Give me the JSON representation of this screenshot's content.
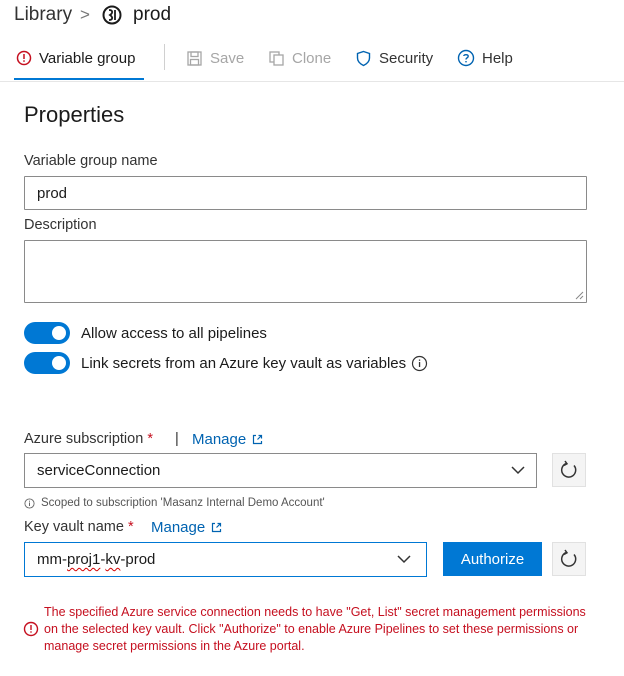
{
  "breadcrumb": {
    "root": "Library",
    "current": "prod"
  },
  "toolbar": {
    "variable_group": "Variable group",
    "save": "Save",
    "clone": "Clone",
    "security": "Security",
    "help": "Help"
  },
  "properties": {
    "title": "Properties",
    "name_label": "Variable group name",
    "name_value": "prod",
    "description_label": "Description",
    "description_value": ""
  },
  "toggles": {
    "allow_access": "Allow access to all pipelines",
    "allow_access_on": true,
    "link_secrets": "Link secrets from an Azure key vault as variables",
    "link_secrets_on": true
  },
  "subscription": {
    "label": "Azure subscription",
    "required_mark": "*",
    "separator": "|",
    "manage": "Manage",
    "value": "serviceConnection",
    "scope_hint": "Scoped to subscription 'Masanz Internal Demo Account'"
  },
  "keyvault": {
    "label": "Key vault name",
    "required_mark": "*",
    "manage": "Manage",
    "value_prefix": "mm-",
    "value_squiggle1": "proj1",
    "value_mid": "-",
    "value_squiggle2": "kv",
    "value_suffix": "-prod",
    "authorize": "Authorize"
  },
  "error": {
    "line1": "The specified Azure service connection needs to have \"Get, List\" secret management permissions",
    "line2": "on the selected key vault. Click \"Authorize\" to enable Azure Pipelines to set these permissions or",
    "line3": "manage secret permissions in the Azure portal."
  },
  "colors": {
    "accent": "#0078d4",
    "error": "#c50f1f",
    "link": "#0063b1"
  }
}
